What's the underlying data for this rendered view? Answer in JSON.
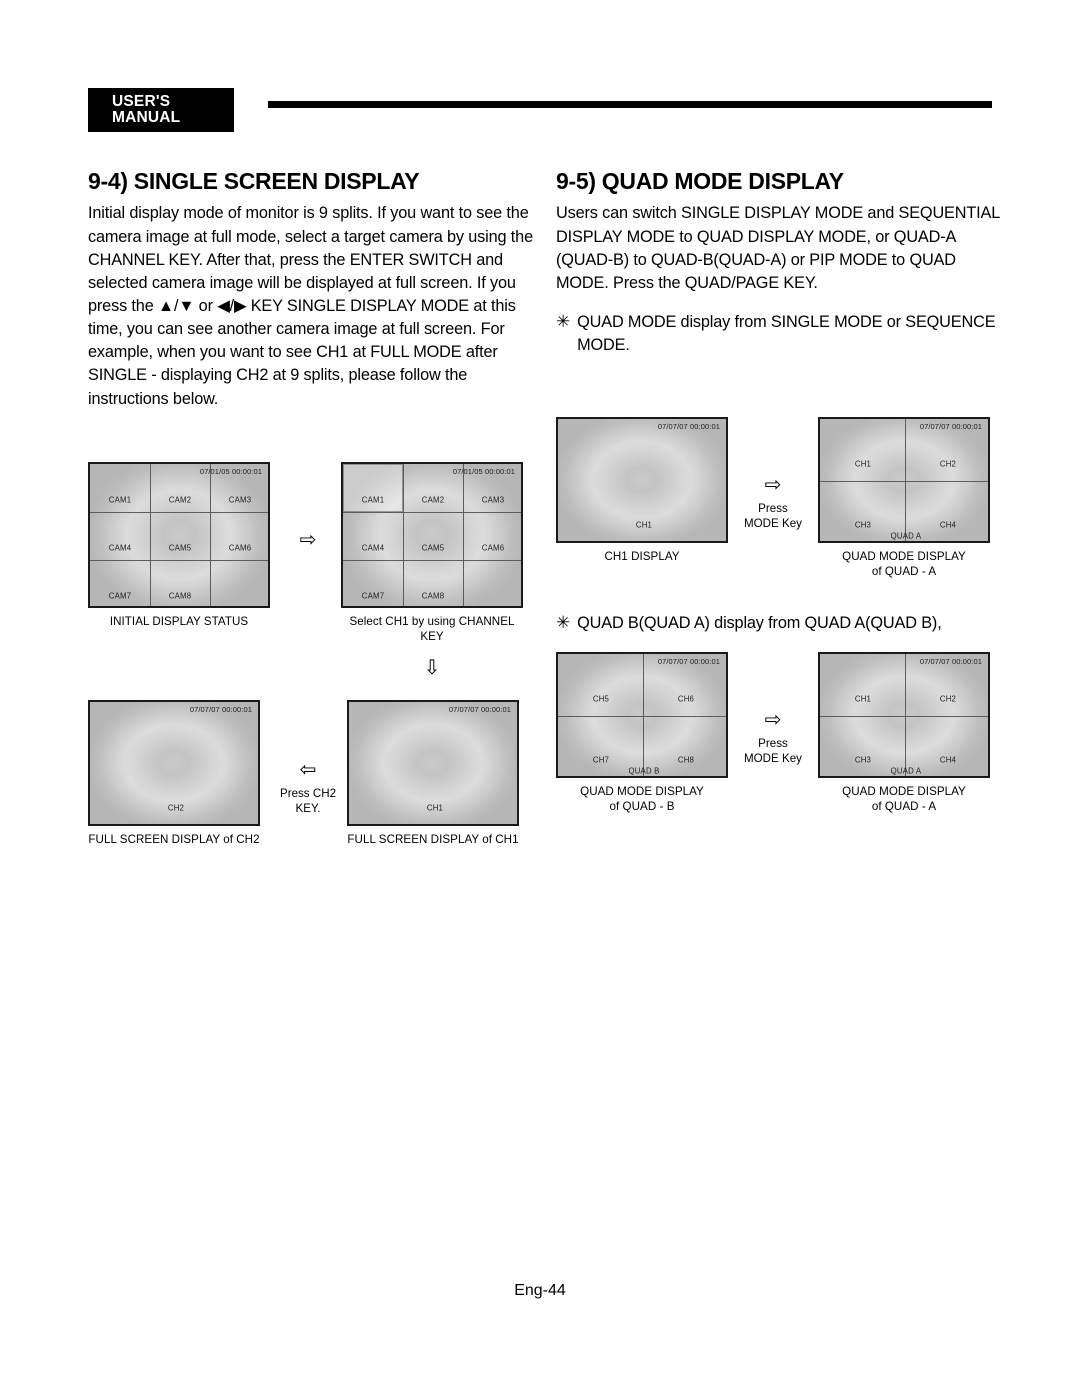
{
  "header": {
    "badge": "USER'S MANUAL"
  },
  "left": {
    "title": "9-4) SINGLE SCREEN DISPLAY",
    "body": "Initial display mode of monitor is 9 splits. If you want to see the camera image at full mode, select a target camera by using the CHANNEL KEY. After that, press the ENTER SWITCH and selected camera image will be displayed at full screen. If you press the ▲/▼ or ◀/▶ KEY SINGLE DISPLAY MODE at this time, you can see another camera image at full screen. For example, when you want to see CH1 at FULL MODE after SINGLE - displaying CH2 at 9 splits, please follow the instructions below.",
    "fig_initial": {
      "timestamp": "07/01/05  00:00:01",
      "cells": [
        "CAM1",
        "CAM2",
        "CAM3",
        "CAM4",
        "CAM5",
        "CAM6",
        "CAM7",
        "CAM8",
        ""
      ],
      "caption": "INITIAL DISPLAY STATUS"
    },
    "arrow_right_1": "⇨",
    "fig_select": {
      "timestamp": "07/01/05  00:00:01",
      "cells": [
        "CAM1",
        "CAM2",
        "CAM3",
        "CAM4",
        "CAM5",
        "CAM6",
        "CAM7",
        "CAM8",
        ""
      ],
      "selected_cell": "CAM1",
      "caption": "Select CH1 by using CHANNEL KEY"
    },
    "arrow_down": "⇩",
    "fig_full_ch1": {
      "timestamp": "07/07/07  00:00:01",
      "channel": "CH1",
      "caption": "FULL SCREEN DISPLAY of CH1"
    },
    "arrow_left_block": {
      "glyph": "⇦",
      "line1": "Press CH2",
      "line2": "KEY."
    },
    "fig_full_ch2": {
      "timestamp": "07/07/07  00:00:01",
      "channel": "CH2",
      "caption": "FULL SCREEN DISPLAY of CH2"
    }
  },
  "right": {
    "title": "9-5) QUAD MODE DISPLAY",
    "body": "Users can switch SINGLE DISPLAY MODE and SEQUENTIAL DISPLAY MODE to QUAD DISPLAY MODE, or QUAD-A (QUAD-B) to QUAD-B(QUAD-A) or PIP MODE to QUAD MODE. Press the QUAD/PAGE KEY.",
    "note1_star": "✳",
    "note1": "QUAD MODE display from SINGLE MODE or SEQUENCE MODE.",
    "fig_ch1_display": {
      "timestamp": "07/07/07  00:00:01",
      "channel": "CH1",
      "caption": "CH1 DISPLAY"
    },
    "arrow_mode_1": {
      "glyph": "⇨",
      "line1": "Press",
      "line2": "MODE Key"
    },
    "fig_quad_a_top": {
      "timestamp": "07/07/07  00:00:01",
      "cells": [
        "CH1",
        "CH2",
        "CH3",
        "CH4"
      ],
      "mode_label": "QUAD  A",
      "caption_line1": "QUAD MODE DISPLAY",
      "caption_line2": "of QUAD - A"
    },
    "note2_star": "✳",
    "note2": "QUAD B(QUAD A) display from QUAD A(QUAD B),",
    "fig_quad_b": {
      "timestamp": "07/07/07  00:00:01",
      "cells": [
        "CH5",
        "CH6",
        "CH7",
        "CH8"
      ],
      "mode_label": "QUAD  B",
      "caption_line1": "QUAD MODE DISPLAY",
      "caption_line2": "of QUAD - B"
    },
    "arrow_mode_2": {
      "glyph": "⇨",
      "line1": "Press",
      "line2": "MODE Key"
    },
    "fig_quad_a_bottom": {
      "timestamp": "07/07/07  00:00:01",
      "cells": [
        "CH1",
        "CH2",
        "CH3",
        "CH4"
      ],
      "mode_label": "QUAD  A",
      "caption_line1": "QUAD MODE DISPLAY",
      "caption_line2": "of QUAD - A"
    }
  },
  "footer": {
    "page": "Eng-44"
  }
}
